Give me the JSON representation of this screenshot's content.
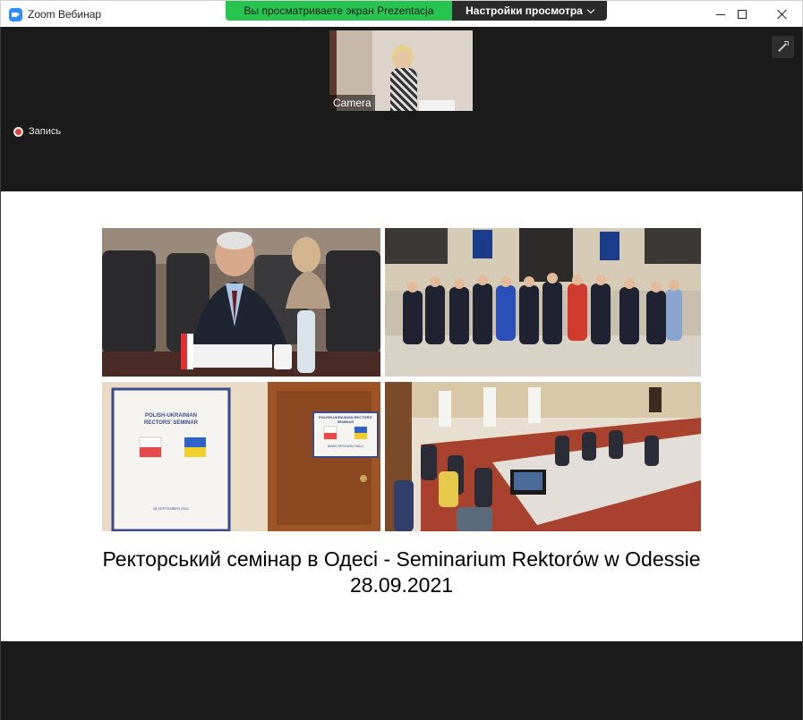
{
  "window": {
    "title": "Zoom Вебинар",
    "icon": "zoom-logo-icon"
  },
  "share_banner": {
    "status": "Вы просматриваете экран Prezentacja",
    "view_options": "Настройки просмотра"
  },
  "camera": {
    "label": "Camera"
  },
  "recording": {
    "label": "Запись",
    "color": "#e0433c"
  },
  "slide": {
    "caption_line1": "Ректорський семінар в Одесі - Seminarium Rektorów w Odessie",
    "caption_line2": "28.09.2021",
    "poster": {
      "title": "POLISH-UKRAINIAN RECTORS' SEMINAR",
      "date": "28 SEPTEMBER 2021",
      "door_sign_title": "POLISH-UKRAINIAN RECTORS' SEMINAR",
      "door_sign_sub": "MAIN SESSION HALL"
    }
  },
  "colors": {
    "banner_green": "#27c450",
    "banner_dark": "#2b2b2b",
    "background": "#1a1a1a",
    "accent_blue": "#2d8cff"
  }
}
